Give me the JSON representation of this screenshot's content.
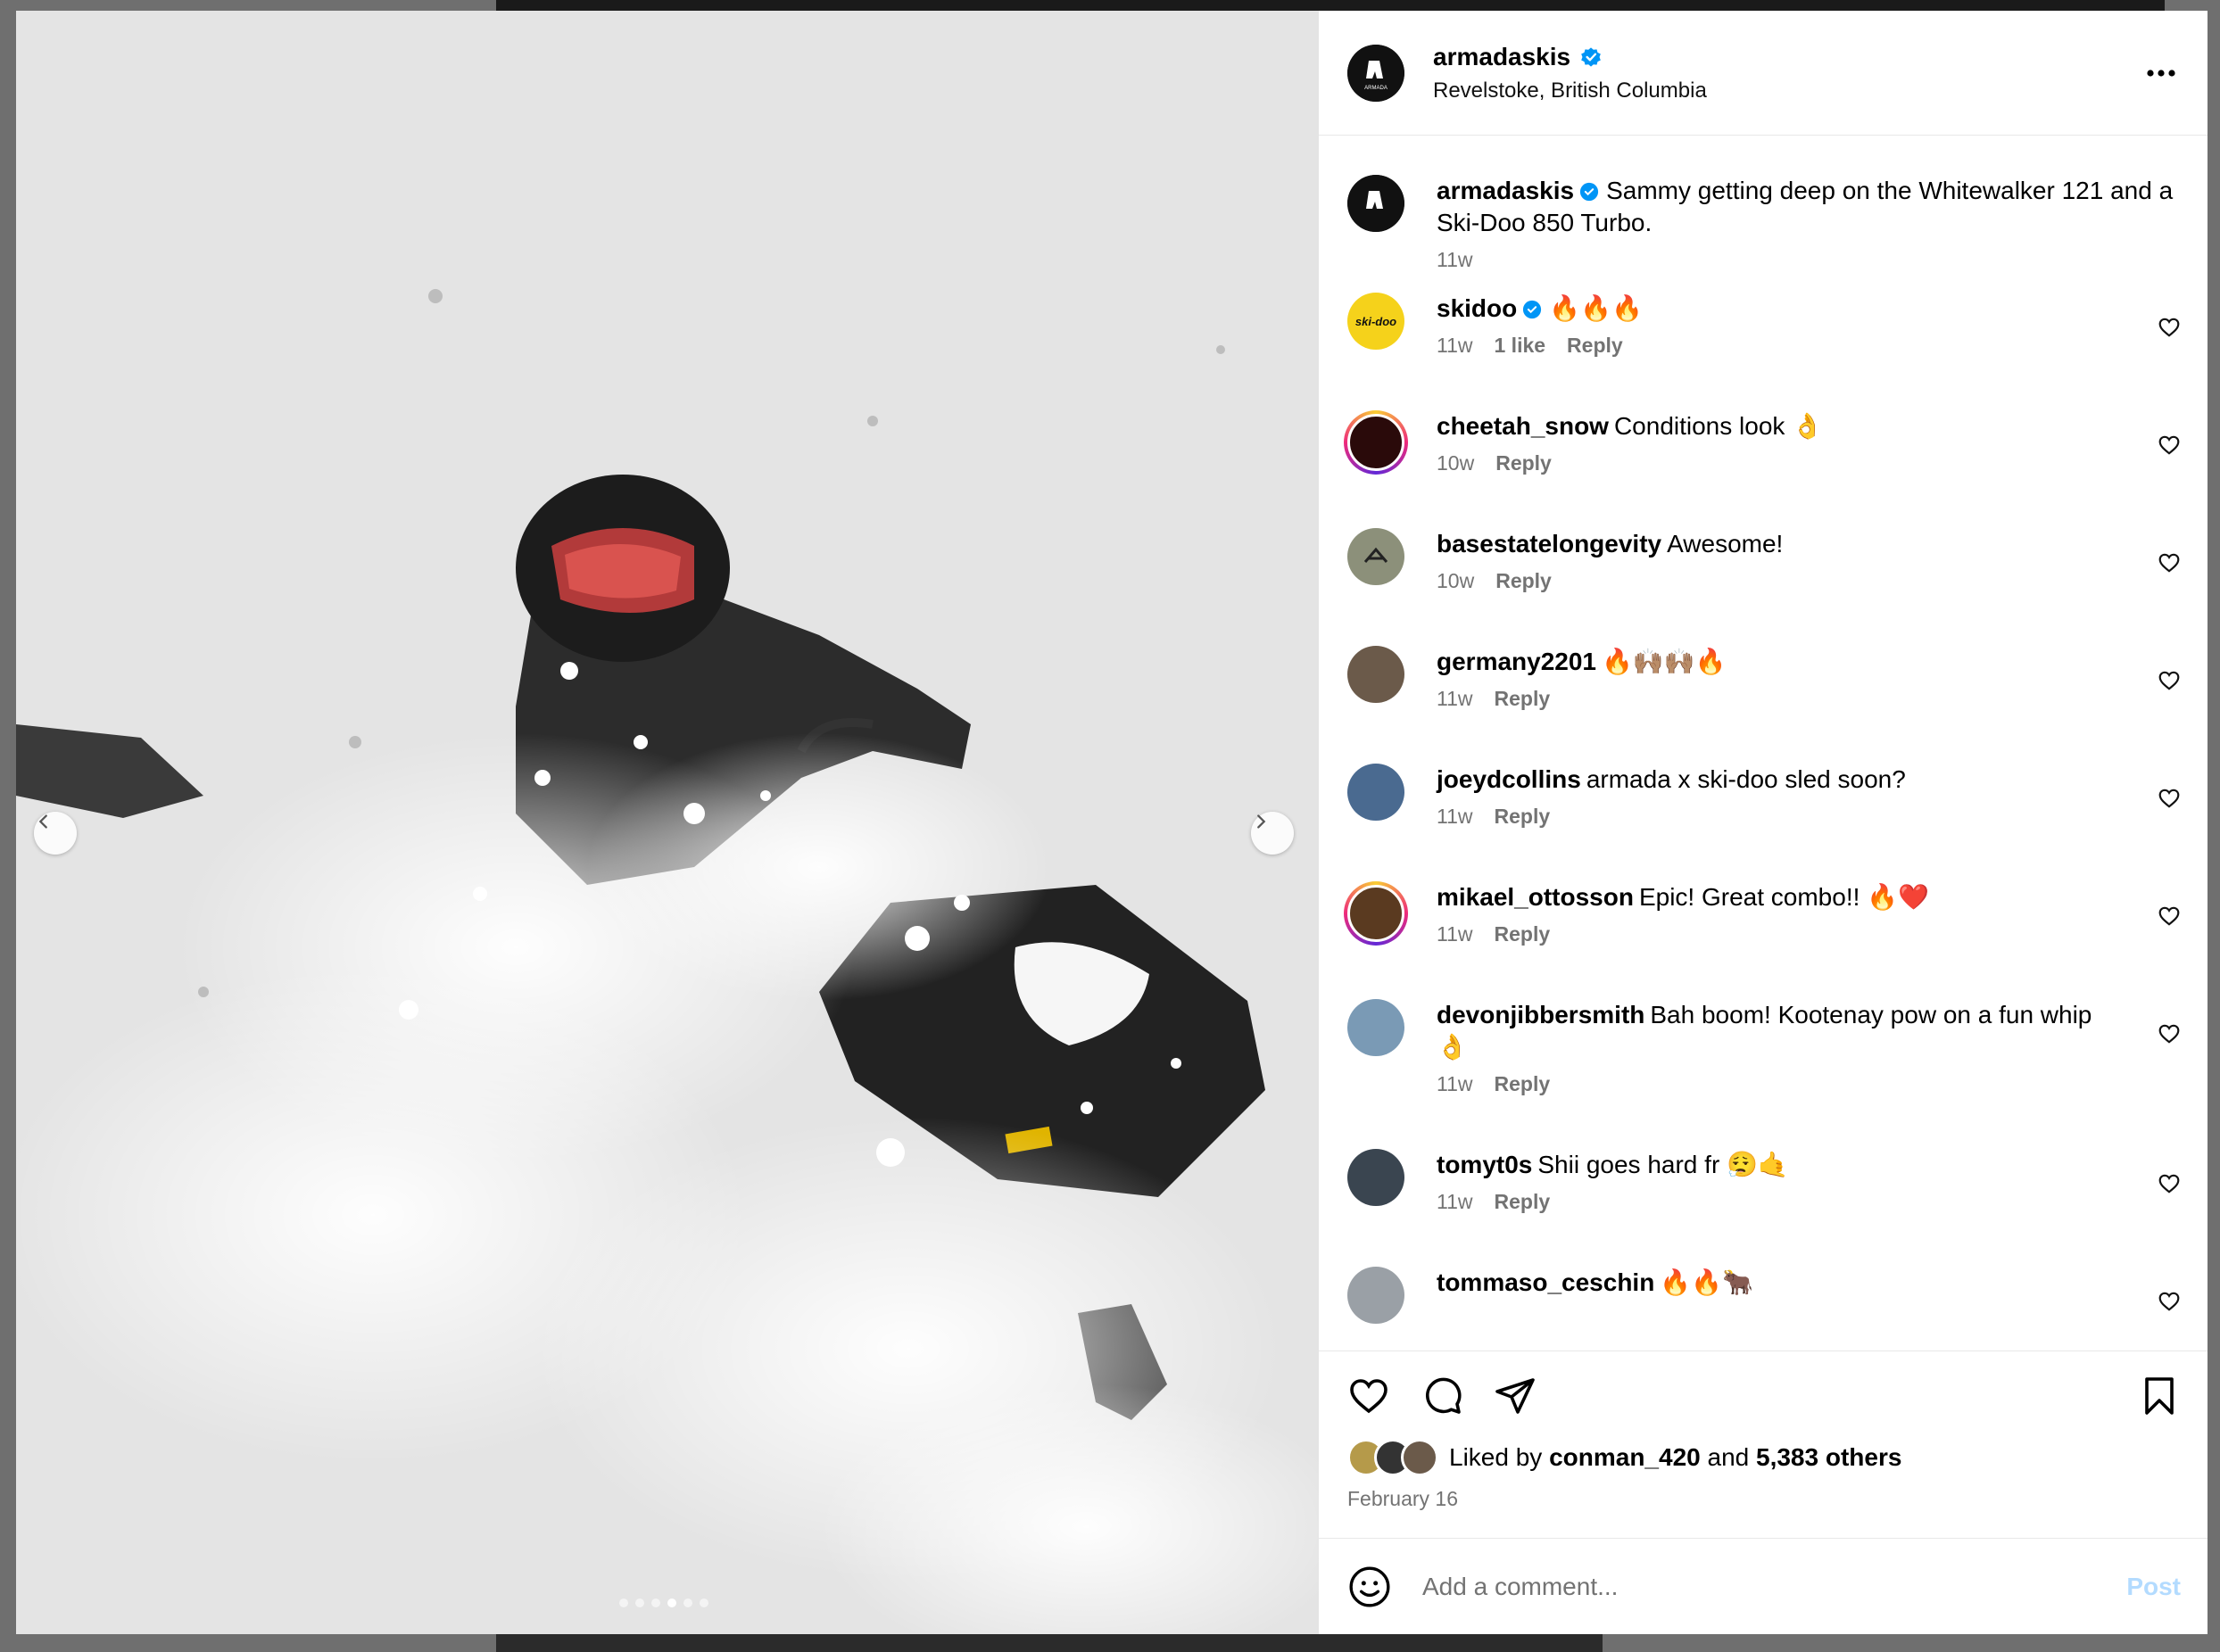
{
  "post": {
    "username": "armadaskis",
    "location": "Revelstoke, British Columbia",
    "caption": "Sammy getting deep on the Whitewalker 121 and a Ski-Doo 850 Turbo.",
    "caption_time": "11w",
    "avatar_text": "ARMADA"
  },
  "carousel": {
    "dots": 5,
    "active_index": 3
  },
  "comments": [
    {
      "user": "skidoo",
      "text": "🔥🔥🔥",
      "time": "11w",
      "likes": "1 like",
      "reply": "Reply",
      "verified": true,
      "avatar_color": "#f5d21b",
      "avatar_label": "ski-doo",
      "ring": false
    },
    {
      "user": "cheetah_snow",
      "text": "Conditions look 👌",
      "time": "10w",
      "reply": "Reply",
      "avatar_color": "#2a0a0a",
      "ring": true
    },
    {
      "user": "basestatelongevity",
      "text": "Awesome!",
      "time": "10w",
      "reply": "Reply",
      "avatar_color": "#8c907a",
      "ring": false
    },
    {
      "user": "germany2201",
      "text": "🔥🙌🏽🙌🏽🔥",
      "time": "11w",
      "reply": "Reply",
      "avatar_color": "#6b5a4a",
      "ring": false
    },
    {
      "user": "joeydcollins",
      "text": "armada x ski-doo sled soon?",
      "time": "11w",
      "reply": "Reply",
      "avatar_color": "#4a6a90",
      "ring": false
    },
    {
      "user": "mikael_ottosson",
      "text": "Epic! Great combo!! 🔥❤️",
      "time": "11w",
      "reply": "Reply",
      "avatar_color": "#5a3a20",
      "ring": true
    },
    {
      "user": "devonjibbersmith",
      "text": "Bah boom! Kootenay pow on a fun whip 👌",
      "time": "11w",
      "reply": "Reply",
      "avatar_color": "#7a9ab5",
      "ring": false
    },
    {
      "user": "tomyt0s",
      "text": "Shii goes hard fr 😮‍💨🤙",
      "time": "11w",
      "reply": "Reply",
      "avatar_color": "#3a4550",
      "ring": false
    },
    {
      "user": "tommaso_ceschin",
      "text": "🔥🔥🐂",
      "time": "",
      "reply": "",
      "avatar_color": "#9aa0a6",
      "ring": false
    }
  ],
  "likes": {
    "prefix": "Liked by",
    "user": "conman_420",
    "joiner": "and",
    "others": "5,383 others"
  },
  "date": "February 16",
  "add_comment": {
    "placeholder": "Add a comment...",
    "post_label": "Post"
  },
  "colors": {
    "verified": "#0095f6",
    "muted": "#737373",
    "post_disabled": "#b3dbff"
  }
}
